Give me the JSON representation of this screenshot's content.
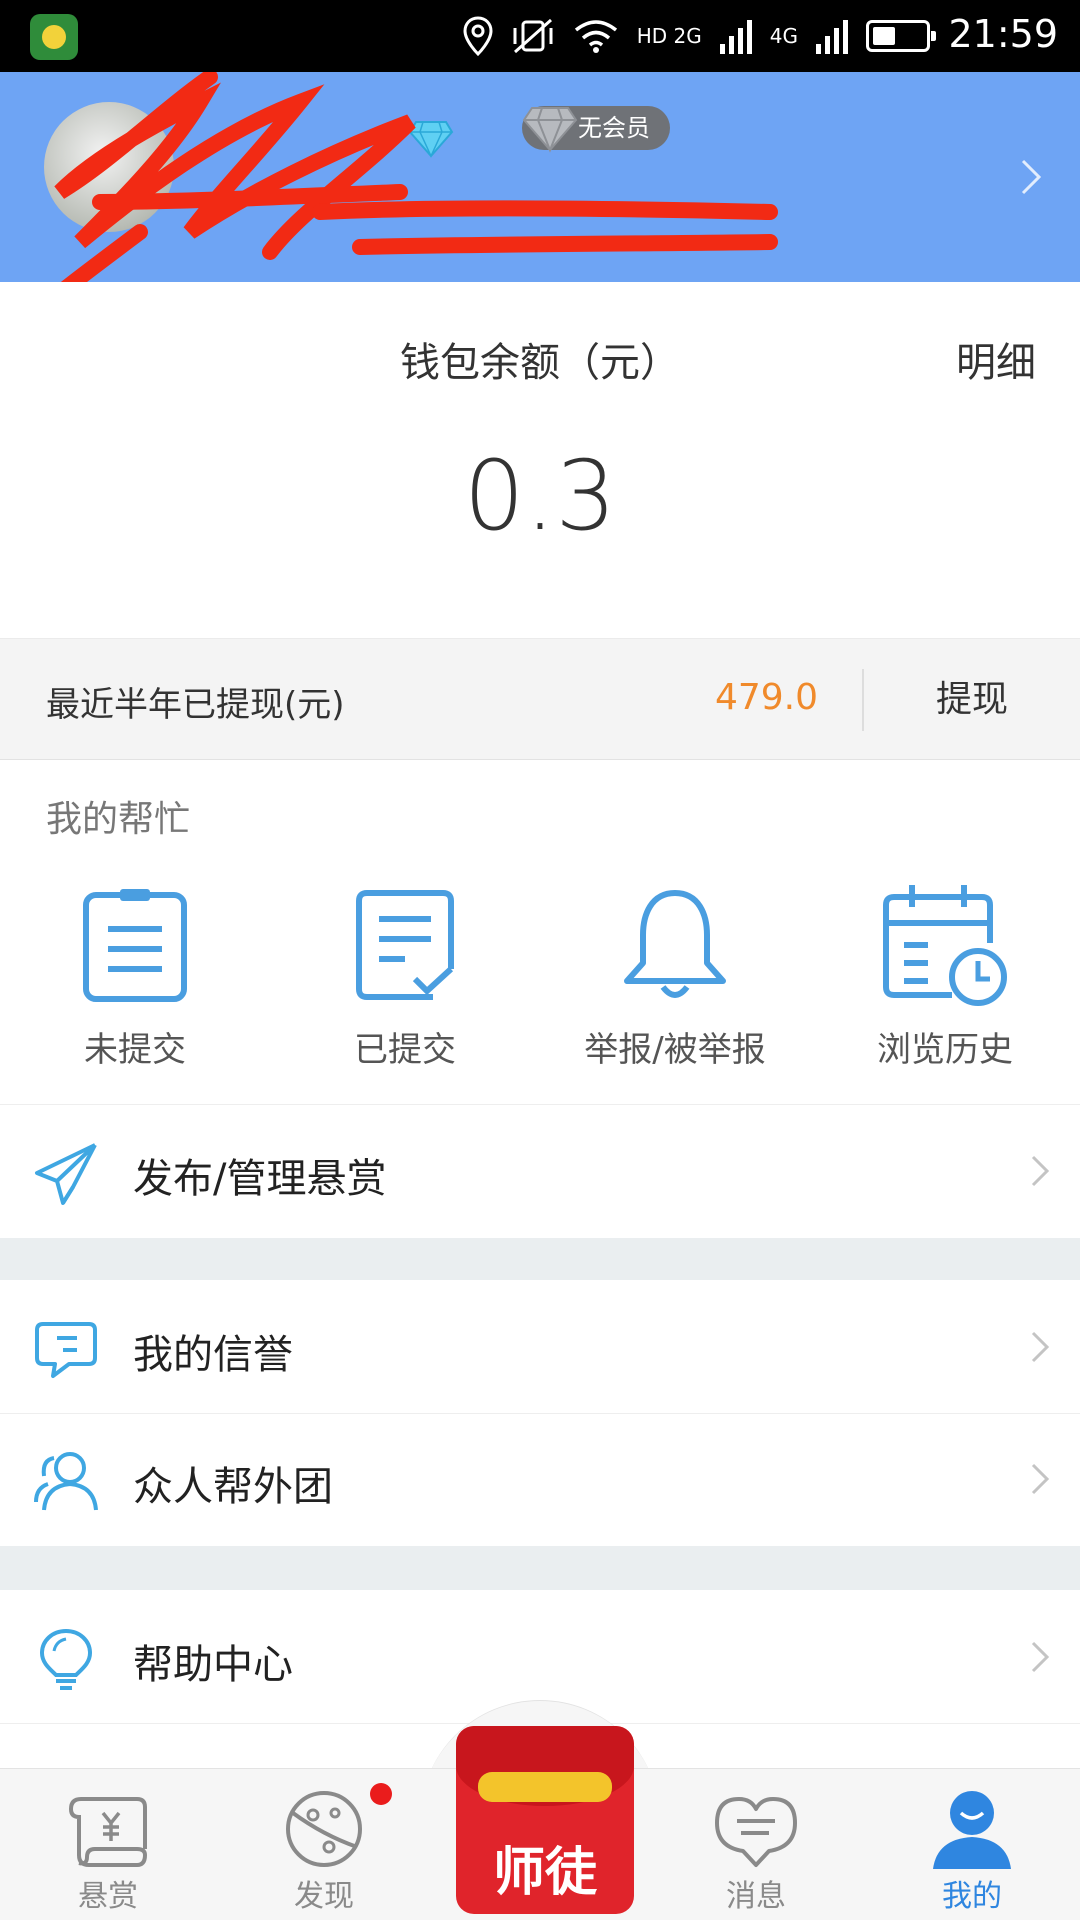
{
  "status_bar": {
    "network_label_1": "HD 2G",
    "network_label_2": "4G",
    "time": "21:59",
    "icons": [
      "location-icon",
      "vibrate-off-icon",
      "wifi-icon",
      "signal-icon",
      "battery-icon"
    ]
  },
  "profile": {
    "member_badge": "无会员",
    "icons": [
      "avatar",
      "diamond-icon",
      "chevron-right-icon"
    ]
  },
  "wallet": {
    "title": "钱包余额（元）",
    "detail_link": "明细",
    "amount": "0.3"
  },
  "withdraw": {
    "label": "最近半年已提现(元)",
    "value": "479.0",
    "button": "提现"
  },
  "my_help": {
    "section_title": "我的帮忙",
    "items": [
      {
        "label": "未提交",
        "icon": "clipboard-icon"
      },
      {
        "label": "已提交",
        "icon": "submitted-doc-icon"
      },
      {
        "label": "举报/被举报",
        "icon": "bell-icon"
      },
      {
        "label": "浏览历史",
        "icon": "calendar-clock-icon"
      }
    ]
  },
  "menu": [
    {
      "label": "发布/管理悬赏",
      "icon": "paper-plane-icon"
    },
    {
      "label": "我的信誉",
      "icon": "chat-bubble-icon"
    },
    {
      "label": "众人帮外团",
      "icon": "people-icon"
    },
    {
      "label": "帮助中心",
      "icon": "lightbulb-icon"
    }
  ],
  "bottom_nav": {
    "items": [
      {
        "label": "悬赏",
        "icon": "scroll-yuan-icon"
      },
      {
        "label": "发现",
        "icon": "planet-icon"
      },
      {
        "label": "师徒",
        "icon": "red-envelope-icon"
      },
      {
        "label": "消息",
        "icon": "heart-bubble-icon"
      },
      {
        "label": "我的",
        "icon": "user-icon"
      }
    ],
    "active": "我的"
  },
  "colors": {
    "header_blue": "#6ea4f4",
    "accent_orange": "#f08a2b",
    "icon_blue": "#4a9ee0",
    "active_blue": "#2f86e0",
    "envelope_red": "#e0242b"
  }
}
